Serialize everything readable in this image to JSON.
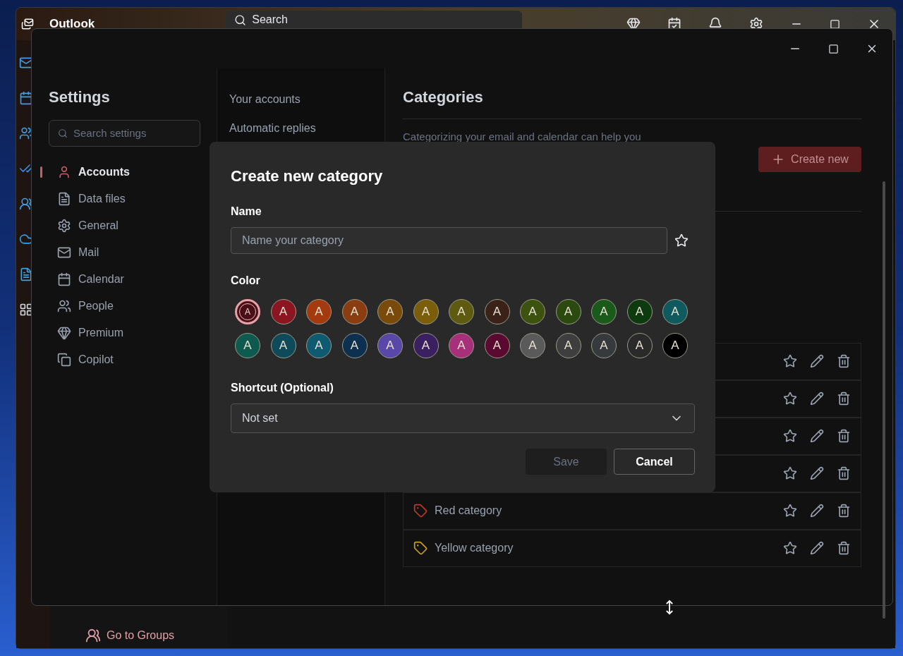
{
  "app_window": {
    "title": "Outlook",
    "search": "Search"
  },
  "background_sidebar": [
    {
      "label": "Go to Groups",
      "kind": "link"
    }
  ],
  "settings": {
    "title": "Settings",
    "search": {
      "placeholder": "Search settings"
    },
    "nav": [
      {
        "label": "Accounts",
        "selected": true
      },
      {
        "label": "Data files",
        "selected": false
      },
      {
        "label": "General",
        "selected": false
      },
      {
        "label": "Mail",
        "selected": false
      },
      {
        "label": "Calendar",
        "selected": false
      },
      {
        "label": "People",
        "selected": false
      },
      {
        "label": "Premium",
        "selected": false
      },
      {
        "label": "Copilot",
        "selected": false
      }
    ],
    "subnav": [
      {
        "label": "Your accounts"
      },
      {
        "label": "Automatic replies"
      }
    ],
    "page": {
      "title": "Categories",
      "intro": "Categorizing your email and calendar can help you",
      "create_button": "Create new",
      "rows": [
        {
          "kind": "covered"
        },
        {
          "kind": "covered"
        },
        {
          "kind": "covered"
        },
        {
          "kind": "covered"
        },
        {
          "kind": "named",
          "name": "Red category",
          "color": "#c0392b"
        },
        {
          "kind": "named",
          "name": "Yellow category",
          "color": "#c9a227"
        }
      ]
    }
  },
  "dialog": {
    "title": "Create new category",
    "name_label": "Name",
    "name_field": {
      "placeholder": "Name your category"
    },
    "color_label": "Color",
    "swatches": [
      {
        "letter": "A",
        "color": "#4a0e17",
        "selected": true
      },
      {
        "letter": "A",
        "color": "#8b1520",
        "selected": false
      },
      {
        "letter": "A",
        "color": "#a33a10",
        "selected": false
      },
      {
        "letter": "A",
        "color": "#8a3d10",
        "selected": false
      },
      {
        "letter": "A",
        "color": "#7a4a0a",
        "selected": false
      },
      {
        "letter": "A",
        "color": "#7a5e0a",
        "selected": false
      },
      {
        "letter": "A",
        "color": "#5e5a10",
        "selected": false
      },
      {
        "letter": "A",
        "color": "#3a2218",
        "selected": false
      },
      {
        "letter": "A",
        "color": "#3e5210",
        "selected": false
      },
      {
        "letter": "A",
        "color": "#2c4a10",
        "selected": false
      },
      {
        "letter": "A",
        "color": "#1a5a1a",
        "selected": false
      },
      {
        "letter": "A",
        "color": "#0e3a10",
        "selected": false
      },
      {
        "letter": "A",
        "color": "#0e5a5e",
        "selected": false
      },
      {
        "letter": "A",
        "color": "#0e5a4e",
        "selected": false
      },
      {
        "letter": "A",
        "color": "#0e4a5a",
        "selected": false
      },
      {
        "letter": "A",
        "color": "#0e5a70",
        "selected": false
      },
      {
        "letter": "A",
        "color": "#0e3050",
        "selected": false
      },
      {
        "letter": "A",
        "color": "#5a48a8",
        "selected": false
      },
      {
        "letter": "A",
        "color": "#3a2060",
        "selected": false
      },
      {
        "letter": "A",
        "color": "#a8307a",
        "selected": false
      },
      {
        "letter": "A",
        "color": "#5a0a30",
        "selected": false
      },
      {
        "letter": "A",
        "color": "#5a5a5a",
        "selected": false
      },
      {
        "letter": "A",
        "color": "#3e3e3e",
        "selected": false
      },
      {
        "letter": "A",
        "color": "#363a3c",
        "selected": false
      },
      {
        "letter": "A",
        "color": "#2a2a2a",
        "selected": false
      },
      {
        "letter": "A",
        "color": "#000000",
        "selected": false
      }
    ],
    "shortcut_label": "Shortcut (Optional)",
    "shortcut_value": "Not set",
    "save": {
      "label": "Save",
      "disabled": true
    },
    "cancel": {
      "label": "Cancel",
      "disabled": false
    }
  }
}
